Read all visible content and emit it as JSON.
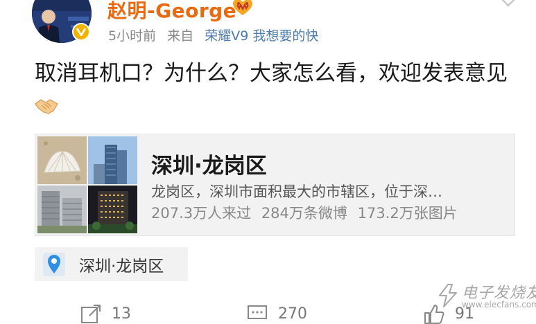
{
  "post": {
    "author": {
      "name": "赵明-George",
      "avatar_icon": "profile-photo",
      "verified_icon": "verified-v-badge",
      "member_icon": "vip-member-icon"
    },
    "meta": {
      "time": "5小时前",
      "source_prefix": "来自",
      "source_name": "荣耀V9 我想要的快"
    },
    "menu_icon": "chevron-down-icon",
    "text": "取消耳机口？为什么？大家怎么看，欢迎发表意见",
    "text_emoji": "handshake-emoji"
  },
  "location_card": {
    "title": "深圳·龙岗区",
    "description": "龙岗区，深圳市面积最大的市辖区，位于深…",
    "stats": [
      "207.3万人来过",
      "284万条微博",
      "173.2万张图片"
    ]
  },
  "location_tag": {
    "icon": "location-pin-icon",
    "label": "深圳·龙岗区"
  },
  "actions": {
    "repost": {
      "icon": "repost-icon",
      "count": "13"
    },
    "comment": {
      "icon": "comment-icon",
      "count": "270"
    },
    "like": {
      "icon": "like-icon",
      "count": "91"
    }
  },
  "watermark": {
    "title": "电子发烧友",
    "url": "www.elecfans.com"
  },
  "colors": {
    "username": "#eb6a10",
    "source_link": "#4a7bb0",
    "badge": "#f2b300",
    "pin": "#2f8fe6"
  }
}
